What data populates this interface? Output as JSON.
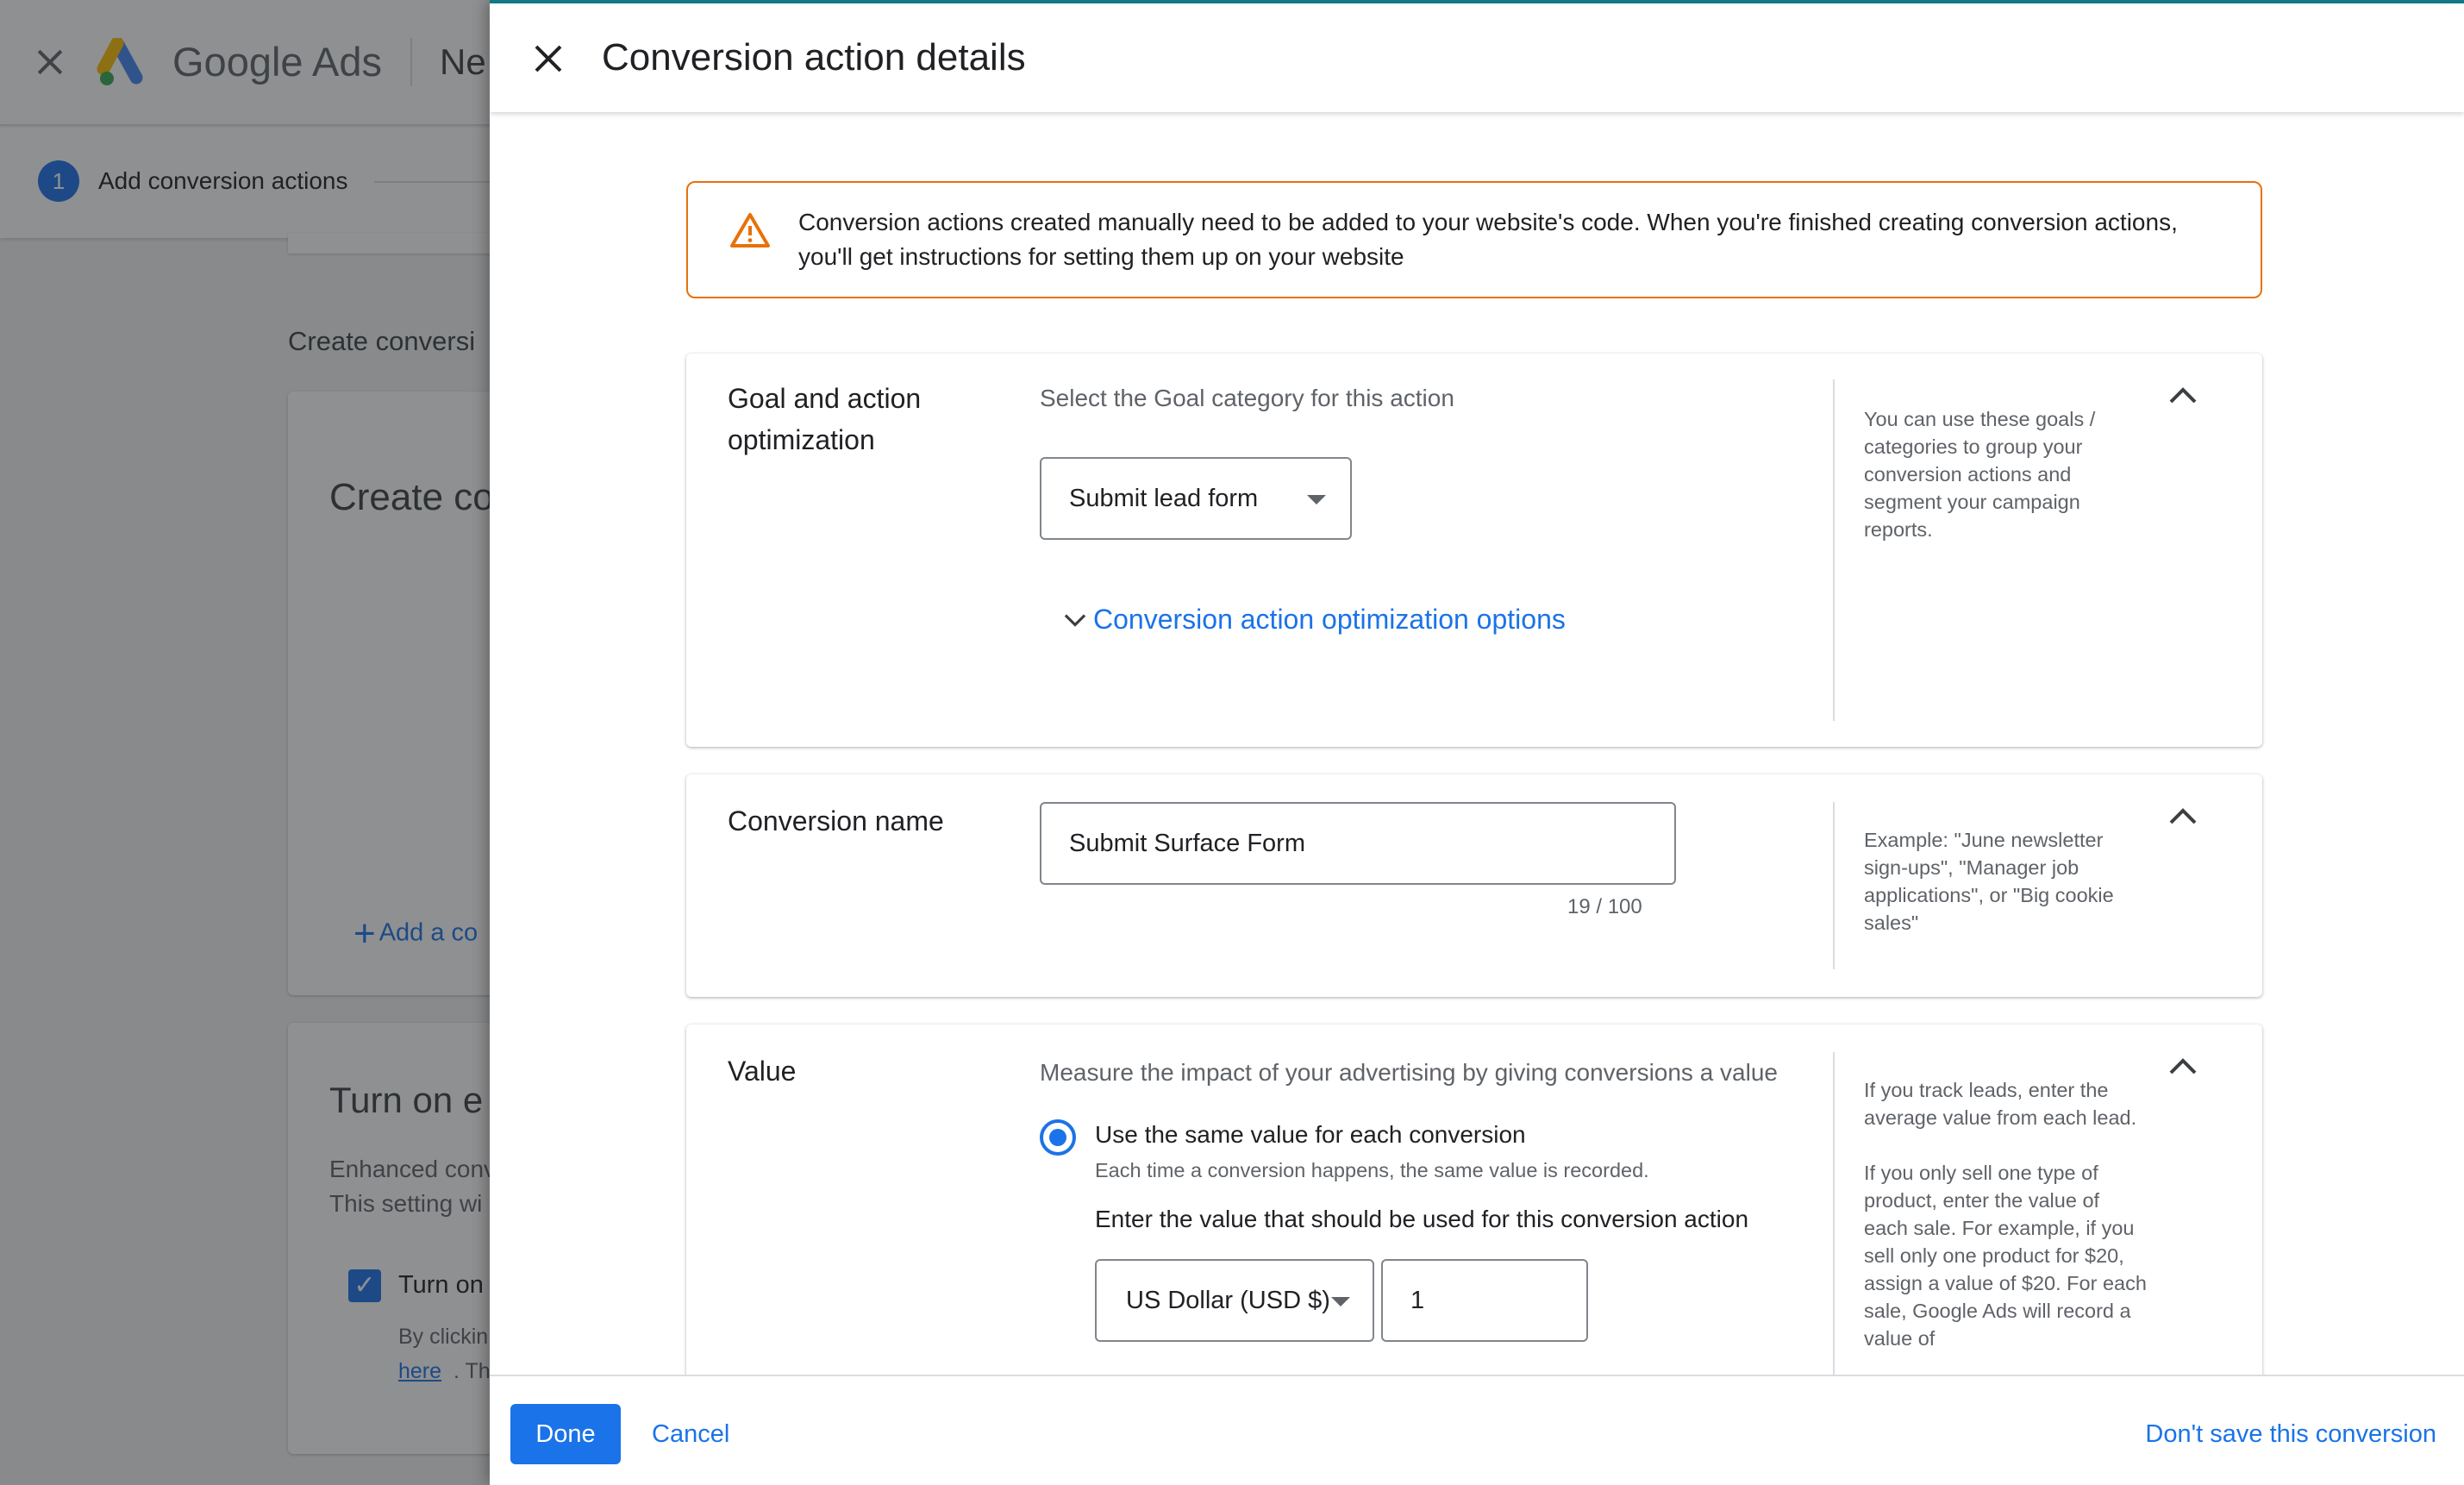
{
  "background": {
    "brand": {
      "google": "Google",
      "ads": "Ads"
    },
    "new_title_partial": "Ne",
    "step": {
      "number": "1",
      "label": "Add conversion actions"
    },
    "create_heading_partial": "Create conversi",
    "card1_title_partial": "Create co",
    "add_link_partial": "Add a co",
    "card2": {
      "title_partial": "Turn on e",
      "desc_line1_partial": "Enhanced conv",
      "desc_line2_partial": "This setting wi",
      "checkbox_label_partial": "Turn on",
      "byclick_partial": "By clickin",
      "here_link": "here",
      "the_partial": ". The"
    }
  },
  "panel": {
    "title": "Conversion action details",
    "warning": {
      "line1": "Conversion actions created manually need to be added to your website's code. When you're finished creating conversion actions,",
      "line2": "you'll get instructions for setting them up on your website"
    },
    "goal_card": {
      "title_line1": "Goal and action",
      "title_line2": "optimization",
      "sublabel": "Select the Goal category for this action",
      "select_value": "Submit lead form",
      "optim_link": "Conversion action optimization options",
      "help": "You can use these goals / categories to group your conversion actions and segment your campaign reports."
    },
    "name_card": {
      "title": "Conversion name",
      "input_value": "Submit Surface Form",
      "counter": "19 / 100",
      "help": "Example: \"June newsletter sign-ups\", \"Manager job applications\", or \"Big cookie sales\""
    },
    "value_card": {
      "title": "Value",
      "sublabel": "Measure the impact of your advertising by giving conversions a value",
      "radio_label": "Use the same value for each conversion",
      "radio_desc": "Each time a conversion happens, the same value is recorded.",
      "enter_label": "Enter the value that should be used for this conversion action",
      "currency": "US Dollar (USD $)",
      "amount": "1",
      "help_p1": "If you track leads, enter the average value from each lead.",
      "help_p2": "If you only sell one type of product, enter the value of each sale. For example, if you sell only one product for $20, assign a value of $20. For each sale, Google Ads will record a value of"
    },
    "footer": {
      "done": "Done",
      "cancel": "Cancel",
      "dont_save": "Don't save this conversion"
    }
  },
  "colors": {
    "accent": "#1a73e8",
    "warning": "#e8710a",
    "top_line": "#137b87"
  },
  "icons": [
    "close-icon",
    "google-ads-logo-icon",
    "warning-triangle-icon",
    "chevron-down-icon",
    "chevron-up-icon",
    "dropdown-caret-icon",
    "plus-icon",
    "checkmark-icon"
  ]
}
